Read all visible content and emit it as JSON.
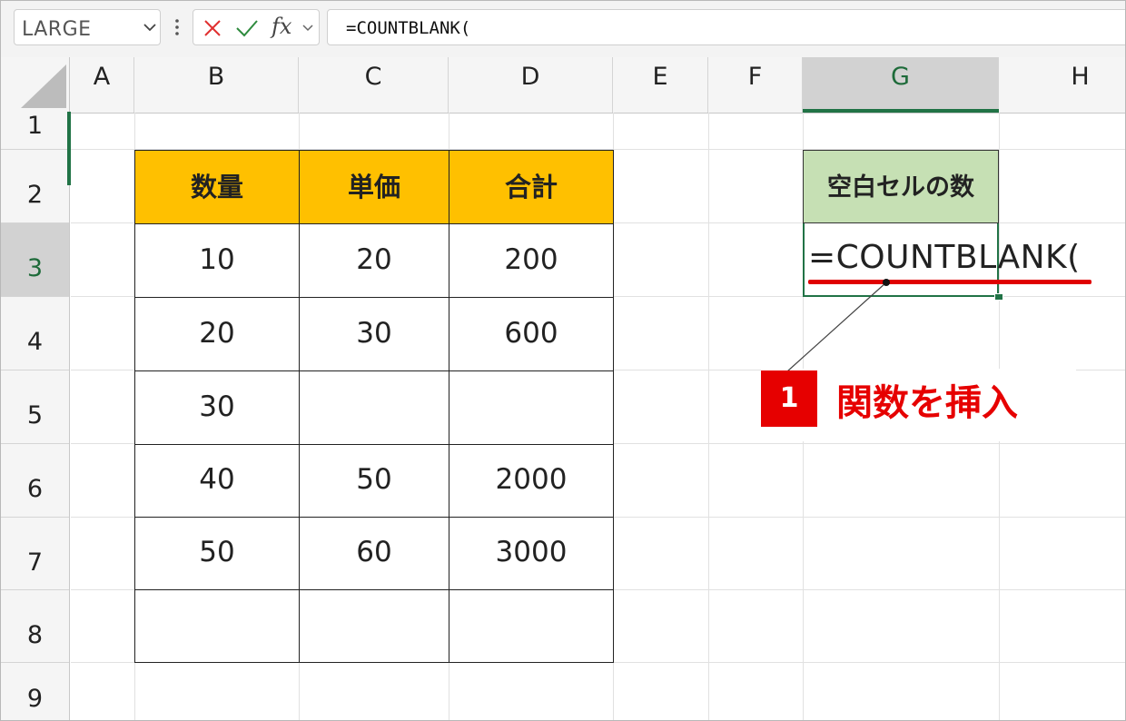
{
  "formula_bar": {
    "name_box": "LARGE",
    "cancel_icon": "x-icon",
    "enter_icon": "check-icon",
    "fx_label": "fx",
    "formula": "=COUNTBLANK("
  },
  "columns": [
    "A",
    "B",
    "C",
    "D",
    "E",
    "F",
    "G",
    "H"
  ],
  "selected_column": "G",
  "rows": [
    "1",
    "2",
    "3",
    "4",
    "5",
    "6",
    "7",
    "8",
    "9"
  ],
  "selected_row": "3",
  "table": {
    "headers": [
      "数量",
      "単価",
      "合計"
    ],
    "rows": [
      [
        "10",
        "20",
        "200"
      ],
      [
        "20",
        "30",
        "600"
      ],
      [
        "30",
        "",
        ""
      ],
      [
        "40",
        "50",
        "2000"
      ],
      [
        "50",
        "60",
        "3000"
      ],
      [
        "",
        "",
        ""
      ]
    ]
  },
  "result": {
    "header": "空白セルの数",
    "editing_formula": "=COUNTBLANK("
  },
  "callout": {
    "step": "1",
    "text": "関数を挿入"
  },
  "colors": {
    "header_fill": "#ffc000",
    "result_header_fill": "#c6e0b4",
    "accent_green": "#217346",
    "callout_red": "#e60000"
  }
}
